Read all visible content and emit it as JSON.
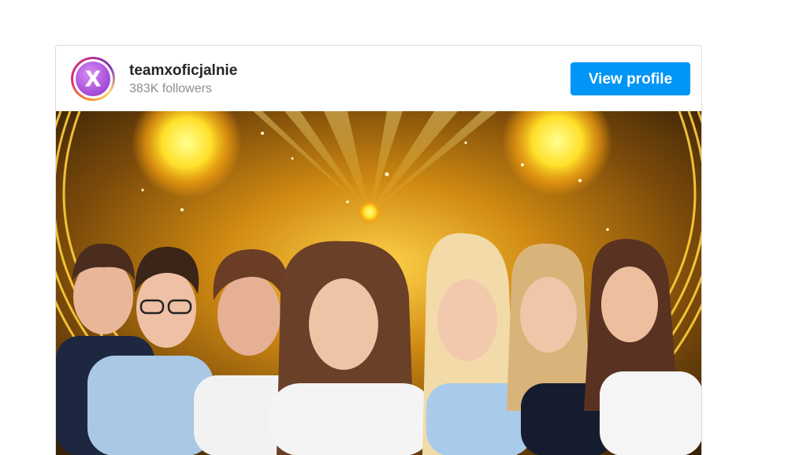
{
  "profile": {
    "username": "teamxoficjalnie",
    "followers": "383K followers",
    "view_profile_label": "View profile"
  },
  "avatar": {
    "logo_letter": "X"
  },
  "colors": {
    "button_bg": "#0095f6",
    "username_text": "#262626",
    "followers_text": "#8e8e8e",
    "border": "#dbdbdb"
  },
  "post": {
    "people_count": 7
  }
}
